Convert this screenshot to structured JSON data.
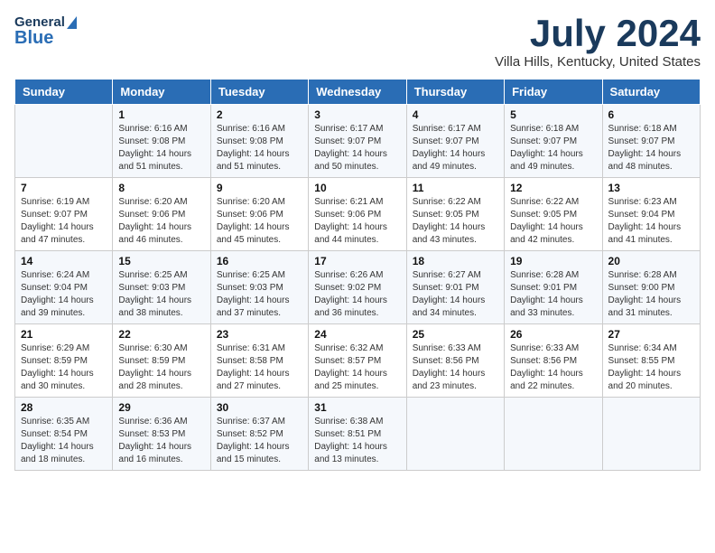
{
  "header": {
    "logo_general": "General",
    "logo_blue": "Blue",
    "month_title": "July 2024",
    "location": "Villa Hills, Kentucky, United States"
  },
  "days_of_week": [
    "Sunday",
    "Monday",
    "Tuesday",
    "Wednesday",
    "Thursday",
    "Friday",
    "Saturday"
  ],
  "weeks": [
    [
      {
        "day": "",
        "sunrise": "",
        "sunset": "",
        "daylight": ""
      },
      {
        "day": "1",
        "sunrise": "Sunrise: 6:16 AM",
        "sunset": "Sunset: 9:08 PM",
        "daylight": "Daylight: 14 hours and 51 minutes."
      },
      {
        "day": "2",
        "sunrise": "Sunrise: 6:16 AM",
        "sunset": "Sunset: 9:08 PM",
        "daylight": "Daylight: 14 hours and 51 minutes."
      },
      {
        "day": "3",
        "sunrise": "Sunrise: 6:17 AM",
        "sunset": "Sunset: 9:07 PM",
        "daylight": "Daylight: 14 hours and 50 minutes."
      },
      {
        "day": "4",
        "sunrise": "Sunrise: 6:17 AM",
        "sunset": "Sunset: 9:07 PM",
        "daylight": "Daylight: 14 hours and 49 minutes."
      },
      {
        "day": "5",
        "sunrise": "Sunrise: 6:18 AM",
        "sunset": "Sunset: 9:07 PM",
        "daylight": "Daylight: 14 hours and 49 minutes."
      },
      {
        "day": "6",
        "sunrise": "Sunrise: 6:18 AM",
        "sunset": "Sunset: 9:07 PM",
        "daylight": "Daylight: 14 hours and 48 minutes."
      }
    ],
    [
      {
        "day": "7",
        "sunrise": "Sunrise: 6:19 AM",
        "sunset": "Sunset: 9:07 PM",
        "daylight": "Daylight: 14 hours and 47 minutes."
      },
      {
        "day": "8",
        "sunrise": "Sunrise: 6:20 AM",
        "sunset": "Sunset: 9:06 PM",
        "daylight": "Daylight: 14 hours and 46 minutes."
      },
      {
        "day": "9",
        "sunrise": "Sunrise: 6:20 AM",
        "sunset": "Sunset: 9:06 PM",
        "daylight": "Daylight: 14 hours and 45 minutes."
      },
      {
        "day": "10",
        "sunrise": "Sunrise: 6:21 AM",
        "sunset": "Sunset: 9:06 PM",
        "daylight": "Daylight: 14 hours and 44 minutes."
      },
      {
        "day": "11",
        "sunrise": "Sunrise: 6:22 AM",
        "sunset": "Sunset: 9:05 PM",
        "daylight": "Daylight: 14 hours and 43 minutes."
      },
      {
        "day": "12",
        "sunrise": "Sunrise: 6:22 AM",
        "sunset": "Sunset: 9:05 PM",
        "daylight": "Daylight: 14 hours and 42 minutes."
      },
      {
        "day": "13",
        "sunrise": "Sunrise: 6:23 AM",
        "sunset": "Sunset: 9:04 PM",
        "daylight": "Daylight: 14 hours and 41 minutes."
      }
    ],
    [
      {
        "day": "14",
        "sunrise": "Sunrise: 6:24 AM",
        "sunset": "Sunset: 9:04 PM",
        "daylight": "Daylight: 14 hours and 39 minutes."
      },
      {
        "day": "15",
        "sunrise": "Sunrise: 6:25 AM",
        "sunset": "Sunset: 9:03 PM",
        "daylight": "Daylight: 14 hours and 38 minutes."
      },
      {
        "day": "16",
        "sunrise": "Sunrise: 6:25 AM",
        "sunset": "Sunset: 9:03 PM",
        "daylight": "Daylight: 14 hours and 37 minutes."
      },
      {
        "day": "17",
        "sunrise": "Sunrise: 6:26 AM",
        "sunset": "Sunset: 9:02 PM",
        "daylight": "Daylight: 14 hours and 36 minutes."
      },
      {
        "day": "18",
        "sunrise": "Sunrise: 6:27 AM",
        "sunset": "Sunset: 9:01 PM",
        "daylight": "Daylight: 14 hours and 34 minutes."
      },
      {
        "day": "19",
        "sunrise": "Sunrise: 6:28 AM",
        "sunset": "Sunset: 9:01 PM",
        "daylight": "Daylight: 14 hours and 33 minutes."
      },
      {
        "day": "20",
        "sunrise": "Sunrise: 6:28 AM",
        "sunset": "Sunset: 9:00 PM",
        "daylight": "Daylight: 14 hours and 31 minutes."
      }
    ],
    [
      {
        "day": "21",
        "sunrise": "Sunrise: 6:29 AM",
        "sunset": "Sunset: 8:59 PM",
        "daylight": "Daylight: 14 hours and 30 minutes."
      },
      {
        "day": "22",
        "sunrise": "Sunrise: 6:30 AM",
        "sunset": "Sunset: 8:59 PM",
        "daylight": "Daylight: 14 hours and 28 minutes."
      },
      {
        "day": "23",
        "sunrise": "Sunrise: 6:31 AM",
        "sunset": "Sunset: 8:58 PM",
        "daylight": "Daylight: 14 hours and 27 minutes."
      },
      {
        "day": "24",
        "sunrise": "Sunrise: 6:32 AM",
        "sunset": "Sunset: 8:57 PM",
        "daylight": "Daylight: 14 hours and 25 minutes."
      },
      {
        "day": "25",
        "sunrise": "Sunrise: 6:33 AM",
        "sunset": "Sunset: 8:56 PM",
        "daylight": "Daylight: 14 hours and 23 minutes."
      },
      {
        "day": "26",
        "sunrise": "Sunrise: 6:33 AM",
        "sunset": "Sunset: 8:56 PM",
        "daylight": "Daylight: 14 hours and 22 minutes."
      },
      {
        "day": "27",
        "sunrise": "Sunrise: 6:34 AM",
        "sunset": "Sunset: 8:55 PM",
        "daylight": "Daylight: 14 hours and 20 minutes."
      }
    ],
    [
      {
        "day": "28",
        "sunrise": "Sunrise: 6:35 AM",
        "sunset": "Sunset: 8:54 PM",
        "daylight": "Daylight: 14 hours and 18 minutes."
      },
      {
        "day": "29",
        "sunrise": "Sunrise: 6:36 AM",
        "sunset": "Sunset: 8:53 PM",
        "daylight": "Daylight: 14 hours and 16 minutes."
      },
      {
        "day": "30",
        "sunrise": "Sunrise: 6:37 AM",
        "sunset": "Sunset: 8:52 PM",
        "daylight": "Daylight: 14 hours and 15 minutes."
      },
      {
        "day": "31",
        "sunrise": "Sunrise: 6:38 AM",
        "sunset": "Sunset: 8:51 PM",
        "daylight": "Daylight: 14 hours and 13 minutes."
      },
      {
        "day": "",
        "sunrise": "",
        "sunset": "",
        "daylight": ""
      },
      {
        "day": "",
        "sunrise": "",
        "sunset": "",
        "daylight": ""
      },
      {
        "day": "",
        "sunrise": "",
        "sunset": "",
        "daylight": ""
      }
    ]
  ]
}
